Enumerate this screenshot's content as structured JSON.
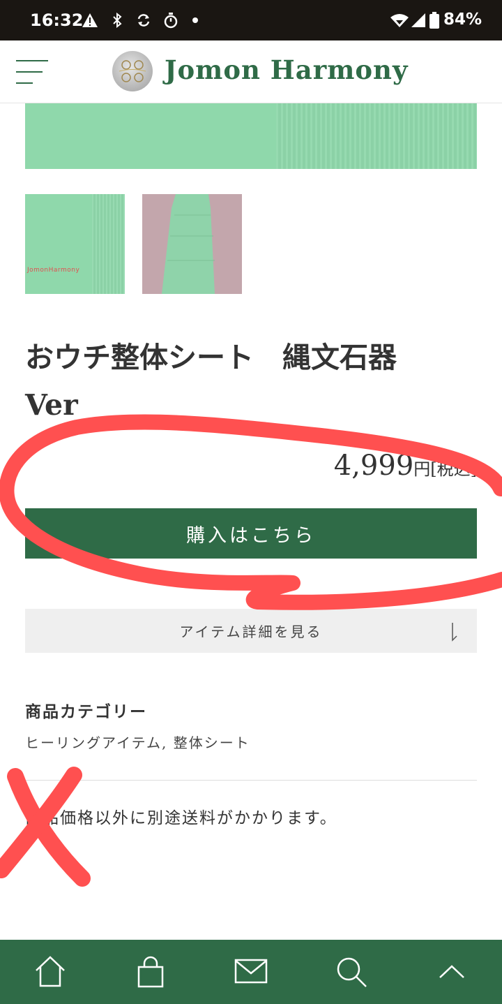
{
  "status_bar": {
    "time": "16:32",
    "battery_text": "84%",
    "icons": [
      "warning-icon",
      "bluetooth-icon",
      "sync-icon",
      "timer-icon",
      "notification-dot-icon",
      "wifi-icon",
      "signal-icon",
      "battery-icon"
    ]
  },
  "header": {
    "site_title": "Jomon Harmony",
    "menu_icon": "hamburger-menu-icon",
    "logo": "jomon-harmony-logo"
  },
  "gallery": {
    "thumb_watermark": "JomonHarmony"
  },
  "product": {
    "title_line1": "おウチ整体シート　縄文石器",
    "title_line2": "Ver",
    "price": "4,999",
    "price_unit": "円[税込]",
    "buy_label": "購入はこちら",
    "details_label": "アイテム詳細を見る"
  },
  "category": {
    "heading": "商品カテゴリー",
    "items": "ヒーリングアイテム, 整体シート"
  },
  "shipping_note": "商品価格以外に別途送料がかかります。",
  "bottom_nav": {
    "items": [
      "home-icon",
      "shopping-bag-icon",
      "mail-icon",
      "search-icon",
      "chevron-up-icon"
    ]
  },
  "colors": {
    "brand_green": "#2f6b47",
    "annotation_red": "#ff5050",
    "product_mint": "#8fd8ab"
  }
}
